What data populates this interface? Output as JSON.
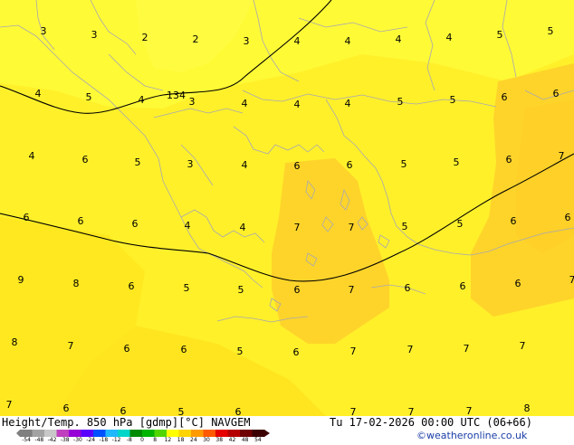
{
  "title": "Height/Temp. 850 hPa [gdmp][°C] NAVGEM",
  "valid_time": "Tu 17-02-2026 00:00 UTC (06+66)",
  "credit": "©weatheronline.co.uk",
  "contour_label": "134",
  "colors": {
    "background_warm": "#ffe81f",
    "background_mild": "#fff02a",
    "background_cool": "#fffa36",
    "hot_patch": "#ffd42a",
    "coastline": "#a8a8b0",
    "contour": "#000000"
  },
  "scale": {
    "ticks": [
      "-54",
      "-48",
      "-42",
      "-38",
      "-30",
      "-24",
      "-18",
      "-12",
      "-8",
      "0",
      "8",
      "12",
      "18",
      "24",
      "30",
      "38",
      "42",
      "48",
      "54"
    ],
    "colors": [
      "#7f7f7f",
      "#a3a3a3",
      "#c8c8c8",
      "#bf3fbf",
      "#9600d6",
      "#5a00ff",
      "#0050ff",
      "#1fb8ff",
      "#00d6c8",
      "#008a00",
      "#00b400",
      "#52d600",
      "#ffff00",
      "#ffd400",
      "#ff9b00",
      "#ff5a00",
      "#e60000",
      "#b40000",
      "#6e0000",
      "#3c0000"
    ]
  },
  "temperature_labels": [
    "3",
    "3",
    "2",
    "2",
    "3",
    "4",
    "4",
    "4",
    "4",
    "5",
    "5",
    "4",
    "5",
    "4",
    "3",
    "4",
    "4",
    "4",
    "5",
    "5",
    "6",
    "6",
    "4",
    "6",
    "5",
    "3",
    "4",
    "6",
    "6",
    "5",
    "5",
    "6",
    "7",
    "6",
    "6",
    "6",
    "4",
    "4",
    "7",
    "7",
    "5",
    "5",
    "6",
    "6",
    "9",
    "8",
    "6",
    "5",
    "5",
    "6",
    "7",
    "6",
    "6",
    "6",
    "7",
    "8",
    "7",
    "6",
    "6",
    "5",
    "6",
    "7",
    "7",
    "7",
    "7",
    "7",
    "6",
    "6",
    "5",
    "6",
    "7",
    "7",
    "7",
    "8"
  ]
}
